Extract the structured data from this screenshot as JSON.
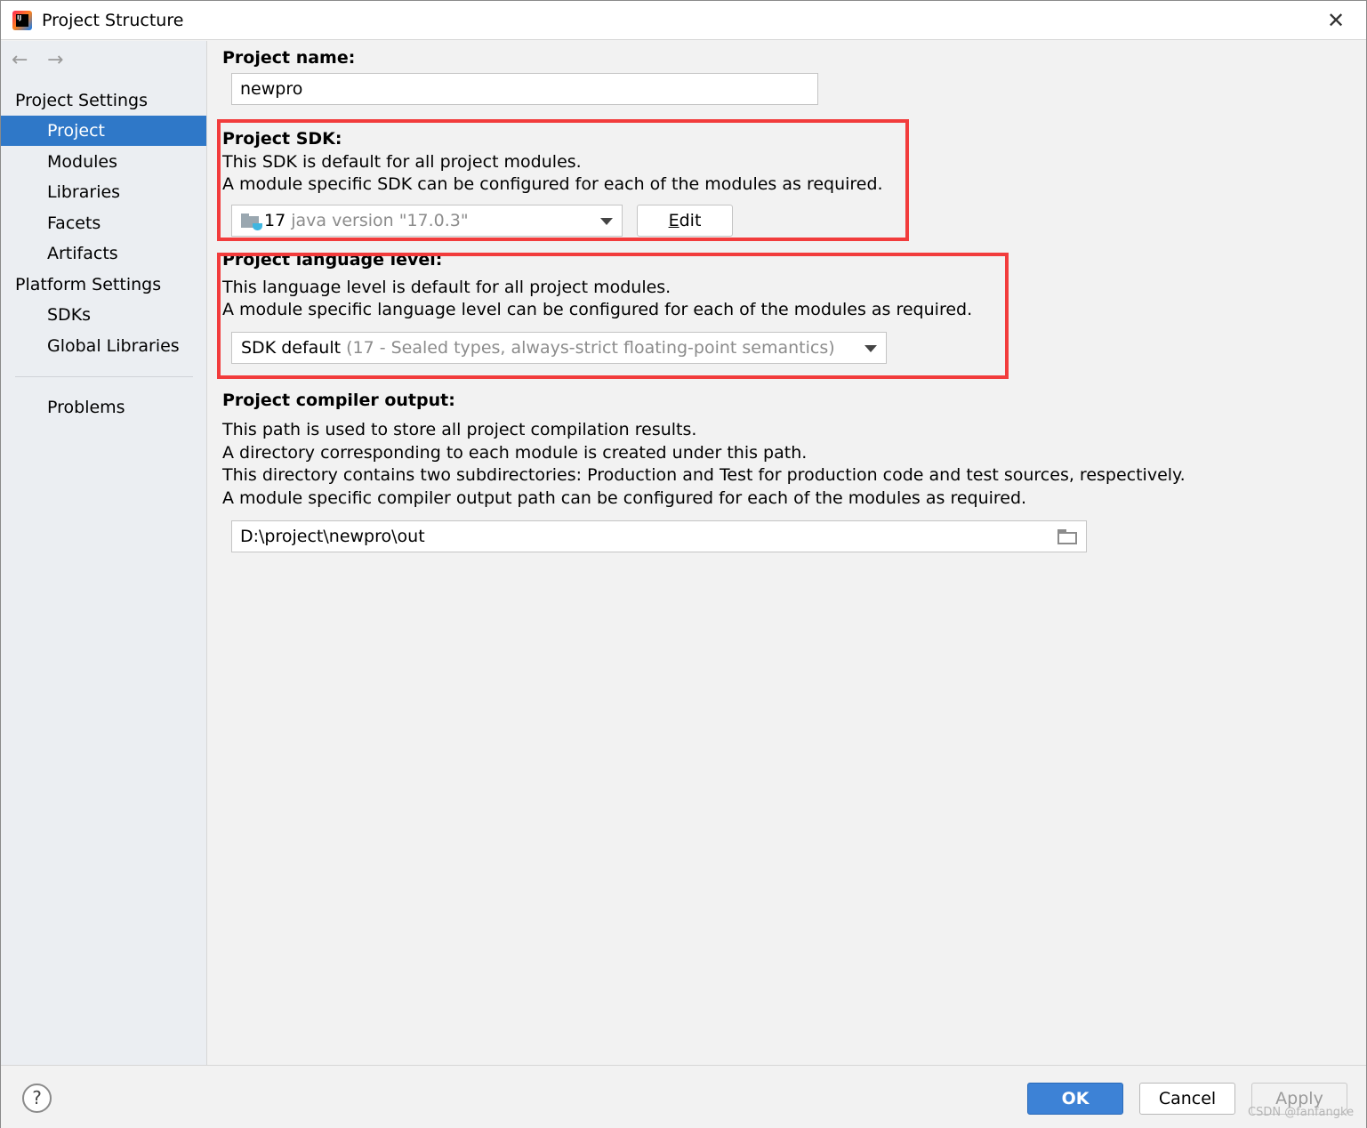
{
  "window": {
    "title": "Project Structure",
    "app_icon": "intellij-idea-icon",
    "close_icon": "close-icon"
  },
  "sidebar": {
    "back_icon": "arrow-left-icon",
    "forward_icon": "arrow-right-icon",
    "sections": [
      {
        "label": "Project Settings",
        "items": [
          "Project",
          "Modules",
          "Libraries",
          "Facets",
          "Artifacts"
        ]
      },
      {
        "label": "Platform Settings",
        "items": [
          "SDKs",
          "Global Libraries"
        ]
      }
    ],
    "problems": "Problems",
    "selected": "Project"
  },
  "content": {
    "project_name": {
      "label": "Project name:",
      "value": "newpro"
    },
    "project_sdk": {
      "label": "Project SDK:",
      "lines": [
        "This SDK is default for all project modules.",
        "A module specific SDK can be configured for each of the modules as required."
      ],
      "selected_main": "17",
      "selected_detail": "java version \"17.0.3\"",
      "edit_button": "Edit"
    },
    "language_level": {
      "label": "Project language level:",
      "lines": [
        "This language level is default for all project modules.",
        "A module specific language level can be configured for each of the modules as required."
      ],
      "selected_main": "SDK default",
      "selected_detail": "(17 - Sealed types, always-strict floating-point semantics)"
    },
    "compiler_output": {
      "label": "Project compiler output:",
      "lines": [
        "This path is used to store all project compilation results.",
        "A directory corresponding to each module is created under this path.",
        "This directory contains two subdirectories: Production and Test for production code and test sources, respectively.",
        "A module specific compiler output path can be configured for each of the modules as required."
      ],
      "value": "D:\\project\\newpro\\out",
      "browse_icon": "folder-open-icon"
    }
  },
  "footer": {
    "help": "?",
    "ok": "OK",
    "cancel": "Cancel",
    "apply": "Apply",
    "watermark": "CSDN @fanfangke"
  },
  "colors": {
    "selection": "#2f78c8",
    "highlight_box": "#f23c3c",
    "ok_button": "#3d82d6"
  }
}
